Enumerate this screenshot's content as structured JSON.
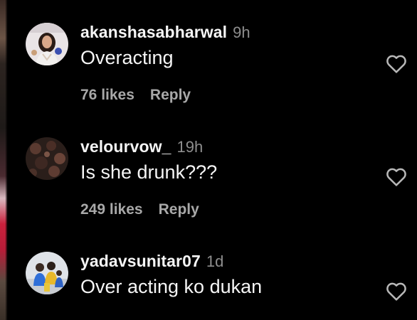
{
  "comments": [
    {
      "username": "akanshasabharwal",
      "time": "9h",
      "text": "Overacting",
      "likes": "76 likes",
      "reply": "Reply",
      "avatar_icon": "profile-photo-woman"
    },
    {
      "username": "velourvow_",
      "time": "19h",
      "text": "Is she drunk???",
      "likes": "249 likes",
      "reply": "Reply",
      "avatar_icon": "profile-photo-dark-pattern"
    },
    {
      "username": "yadavsunitar07",
      "time": "1d",
      "text": "Over acting ko dukan",
      "avatar_icon": "profile-photo-group"
    }
  ],
  "colors": {
    "background": "#000000",
    "primary_text": "#f5f5f5",
    "secondary_text": "#8e8e8e",
    "meta_text": "#a8a8a8"
  },
  "icons": {
    "like": "heart-outline-icon"
  }
}
